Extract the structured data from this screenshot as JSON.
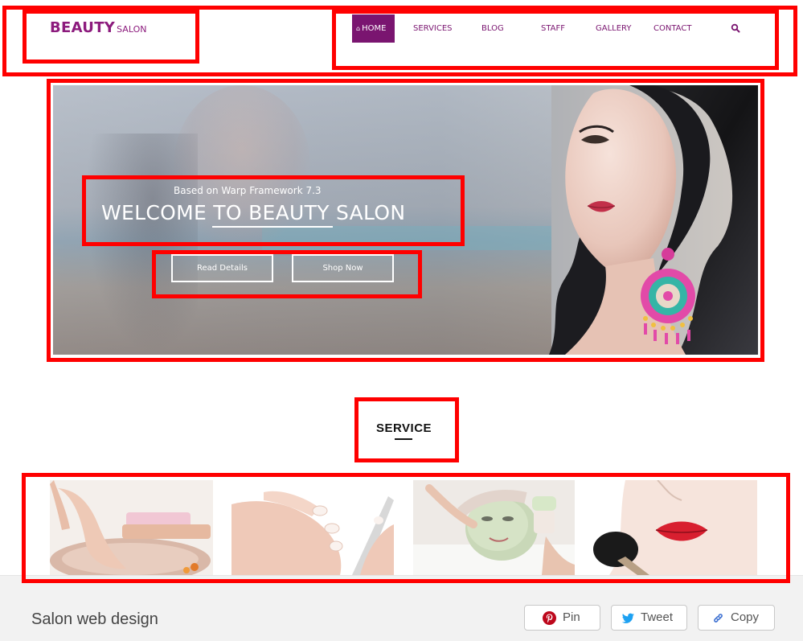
{
  "header": {
    "logo_main": "BEAUTY",
    "logo_sub": "SALON",
    "nav": [
      {
        "label": "HOME",
        "active": true,
        "icon": "home-icon"
      },
      {
        "label": "SERVICES",
        "active": false
      },
      {
        "label": "BLOG",
        "active": false
      },
      {
        "label": "STAFF",
        "active": false
      },
      {
        "label": "GALLERY",
        "active": false
      },
      {
        "label": "CONTACT",
        "active": false
      }
    ],
    "search_icon": "search-icon"
  },
  "hero": {
    "subtitle": "Based on Warp Framework 7.3",
    "title": "WELCOME TO BEAUTY SALON",
    "buttons": [
      {
        "label": "Read Details"
      },
      {
        "label": "Shop Now"
      }
    ]
  },
  "service": {
    "heading": "SERVICE",
    "tiles": [
      "pedicure",
      "manicure",
      "facial-mask",
      "makeup"
    ]
  },
  "footer": {
    "title": "Salon web design",
    "share": [
      {
        "label": "Pin",
        "icon": "pinterest-icon"
      },
      {
        "label": "Tweet",
        "icon": "twitter-icon"
      },
      {
        "label": "Copy",
        "icon": "link-icon"
      }
    ]
  },
  "colors": {
    "brand": "#8c1b7d",
    "nav_active_bg": "#7a1570",
    "annotation": "#ff0000",
    "footer_bg": "#f2f2f2",
    "pinterest": "#bd081c",
    "twitter": "#1da1f2",
    "link": "#3b6fd1"
  }
}
